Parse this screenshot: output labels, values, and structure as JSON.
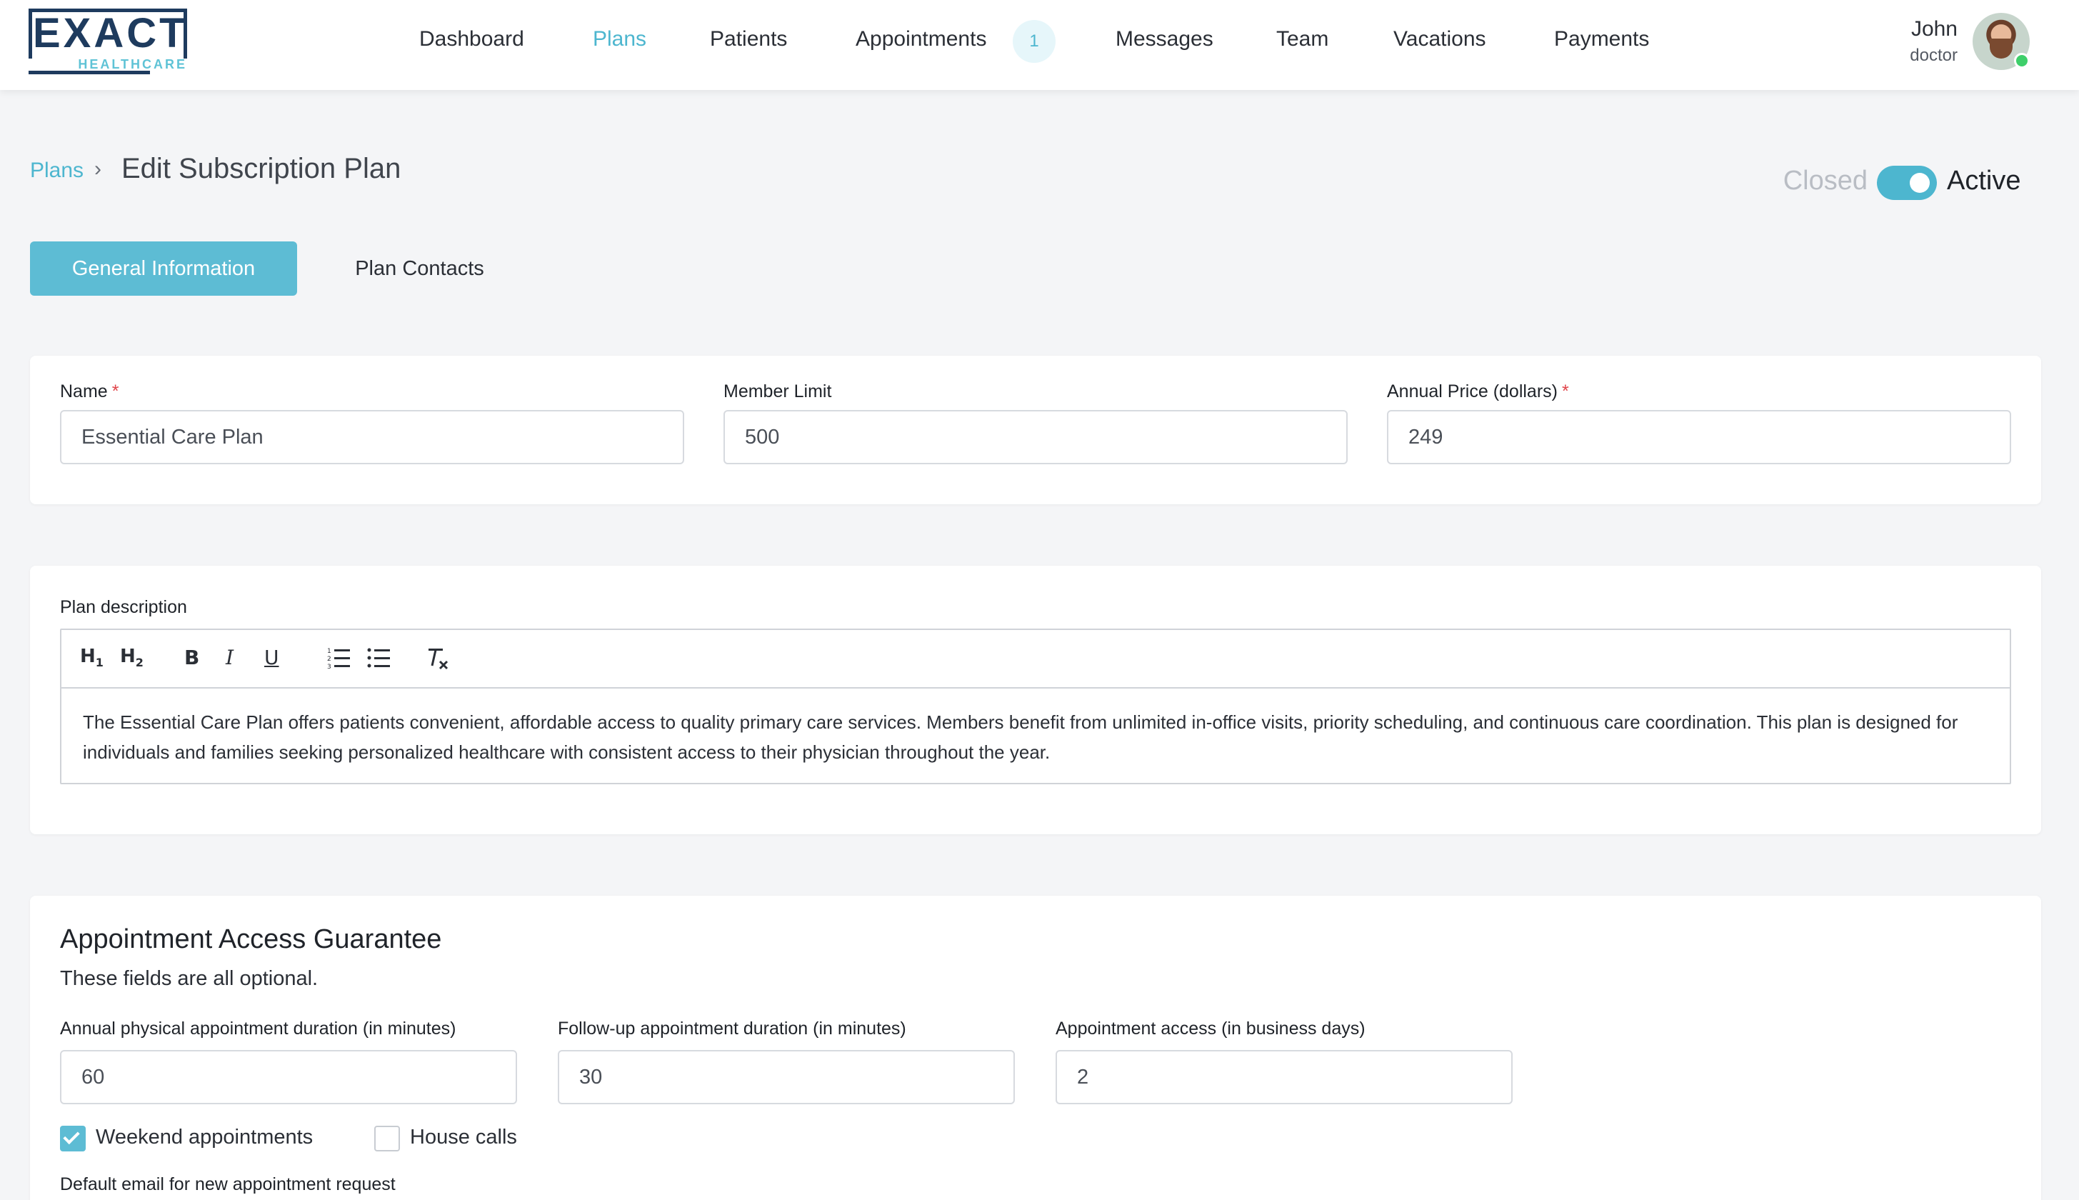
{
  "brand": {
    "logo_text": "EXACT",
    "logo_sub": "HEALTHCARE"
  },
  "nav": {
    "items": [
      "Dashboard",
      "Plans",
      "Patients",
      "Appointments",
      "Messages",
      "Team",
      "Vacations",
      "Payments"
    ],
    "active": "Plans",
    "appointments_badge": "1"
  },
  "user": {
    "name": "John",
    "role": "doctor"
  },
  "header": {
    "breadcrumb_link": "Plans",
    "breadcrumb_separator": "›",
    "title": "Edit Subscription Plan",
    "toggle_off_label": "Closed",
    "toggle_on_label": "Active",
    "toggle_state": "on"
  },
  "tabs": [
    {
      "label": "General Information",
      "active": true
    },
    {
      "label": "Plan Contacts",
      "active": false
    }
  ],
  "basic": {
    "name_label": "Name",
    "name_value": "Essential Care Plan",
    "member_limit_label": "Member Limit",
    "member_limit_value": "500",
    "annual_price_label": "Annual Price (dollars)",
    "annual_price_value": "249",
    "required_mark": "*"
  },
  "description": {
    "label": "Plan description",
    "toolbar": [
      "h1-icon",
      "h2-icon",
      "bold-icon",
      "italic-icon",
      "underline-icon",
      "ordered-list-icon",
      "bullet-list-icon",
      "clear-format-icon"
    ],
    "text": "The Essential Care Plan offers patients convenient, affordable access to quality primary care services. Members benefit from unlimited in-office visits, priority scheduling, and continuous care coordination. This plan is designed for individuals and families seeking personalized healthcare with consistent access to their physician throughout the year."
  },
  "access": {
    "title": "Appointment Access Guarantee",
    "subtitle": "These fields are all optional.",
    "annual_label": "Annual physical appointment duration (in minutes)",
    "annual_value": "60",
    "followup_label": "Follow-up appointment duration (in minutes)",
    "followup_value": "30",
    "access_label": "Appointment access (in business days)",
    "access_value": "2",
    "weekend_label": "Weekend appointments",
    "weekend_checked": true,
    "house_calls_label": "House calls",
    "house_calls_checked": false,
    "default_email_label": "Default email for new appointment request"
  },
  "colors": {
    "accent": "#4db6cf",
    "brand": "#1e3b5e",
    "required": "#e0444a",
    "online": "#3ecf6a"
  }
}
